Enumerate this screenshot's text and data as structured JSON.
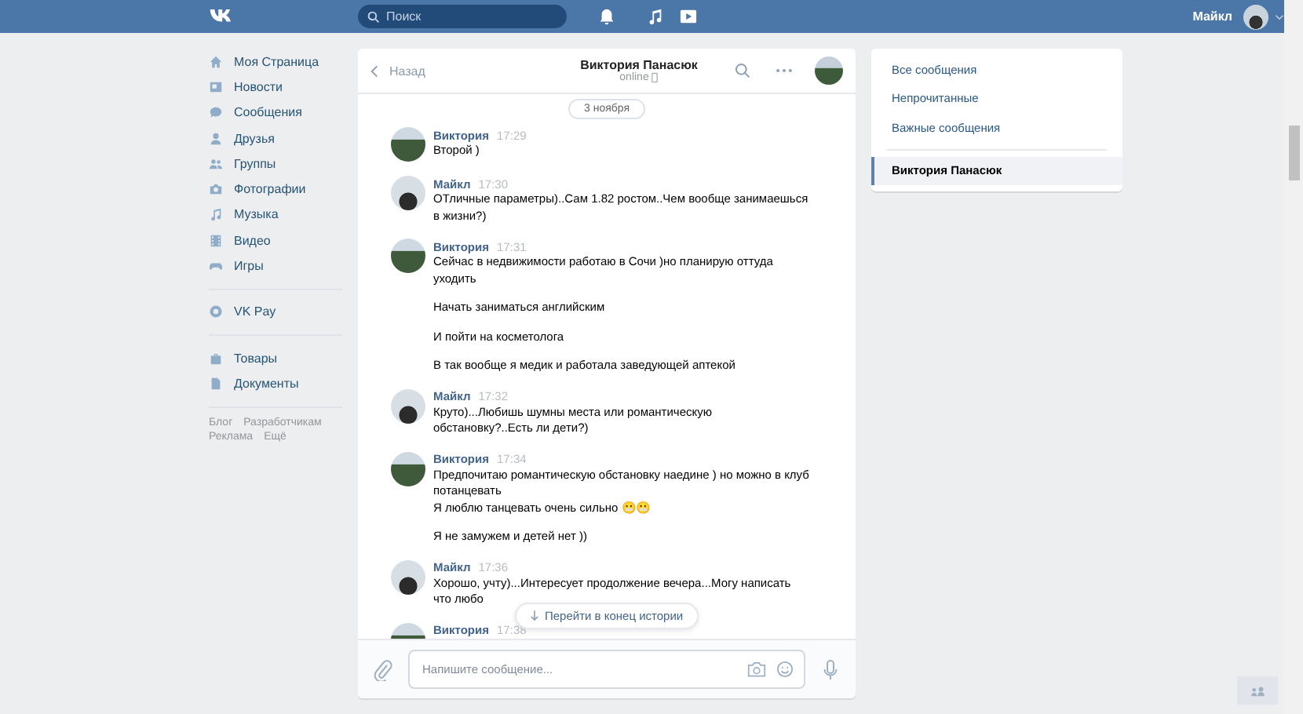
{
  "header": {
    "search": {
      "placeholder": "Поиск"
    },
    "user": "Майкл"
  },
  "nav": {
    "items": [
      {
        "label": "Моя Страница"
      },
      {
        "label": "Новости"
      },
      {
        "label": "Сообщения"
      },
      {
        "label": "Друзья"
      },
      {
        "label": "Группы"
      },
      {
        "label": "Фотографии"
      },
      {
        "label": "Музыка"
      },
      {
        "label": "Видео"
      },
      {
        "label": "Игры"
      }
    ],
    "pay": {
      "label": "VK Pay"
    },
    "extra": [
      {
        "label": "Товары"
      },
      {
        "label": "Документы"
      }
    ],
    "footer": [
      "Блог",
      "Разработчикам",
      "Реклама",
      "Ещё"
    ]
  },
  "chat": {
    "back": "Назад",
    "name": "Виктория Панасюк",
    "status": "online",
    "date": "3 ноября",
    "messages": [
      {
        "author": "Виктория",
        "time": "17:29",
        "paragraphs": [
          "Второй )"
        ]
      },
      {
        "author": "Майкл",
        "time": "17:30",
        "paragraphs": [
          "ОТличные параметры)..Сам 1.82 ростом..Чем вообще занимаешься в жизни?)"
        ]
      },
      {
        "author": "Виктория",
        "time": "17:31",
        "paragraphs": [
          "Сейчас в недвижимости работаю в Сочи )но планирую оттуда уходить",
          "Начать заниматься английским",
          "И пойти на косметолога",
          "В так вообще я медик и работала заведующей аптекой"
        ]
      },
      {
        "author": "Майкл",
        "time": "17:32",
        "paragraphs": [
          "Круто)...Любишь шумны места или романтическую обстановку?..Есть ли дети?)"
        ]
      },
      {
        "author": "Виктория",
        "time": "17:34",
        "paragraphs": [
          "Предпочитаю романтическую обстановку наедине ) но можно в клуб потанцевать\nЯ люблю танцевать очень сильно 😬😬",
          "Я не замужем и детей нет ))"
        ]
      },
      {
        "author": "Майкл",
        "time": "17:36",
        "paragraphs": [
          "Хорошо, учту)...Интересует продолжение вечера...Могу написать что любо"
        ]
      },
      {
        "author": "Виктория",
        "time": "17:38"
      }
    ],
    "jump": "Перейти в конец истории",
    "composer": {
      "placeholder": "Напишите сообщение..."
    }
  },
  "filters": [
    {
      "label": "Все сообщения",
      "selected": false
    },
    {
      "label": "Непрочитанные",
      "selected": false
    },
    {
      "label": "Важные сообщения",
      "selected": false
    },
    {
      "label": "Виктория Панасюк",
      "selected": true
    }
  ]
}
